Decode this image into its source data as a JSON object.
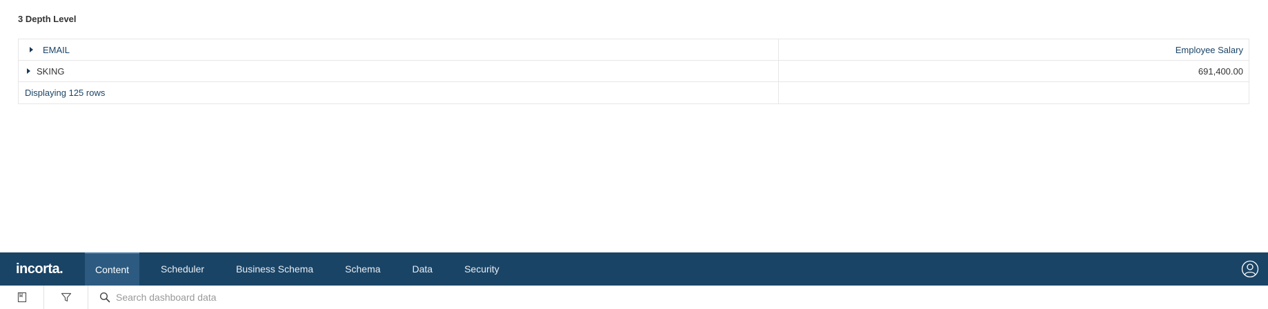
{
  "widget": {
    "title": "3 Depth Level",
    "header_col1": "EMAIL",
    "header_col2": "Employee Salary",
    "rows": [
      {
        "label": "SKING",
        "value": "691,400.00"
      }
    ],
    "footer": "Displaying 125 rows"
  },
  "nav": {
    "logo": "incorta.",
    "tabs": [
      {
        "label": "Content",
        "active": true
      },
      {
        "label": "Scheduler"
      },
      {
        "label": "Business Schema"
      },
      {
        "label": "Schema"
      },
      {
        "label": "Data"
      },
      {
        "label": "Security"
      }
    ]
  },
  "toolbar": {
    "search_placeholder": "Search dashboard data"
  },
  "colors": {
    "nav_bg": "#1a4466",
    "nav_active": "#2c5a80",
    "link_text": "#1a4466"
  }
}
